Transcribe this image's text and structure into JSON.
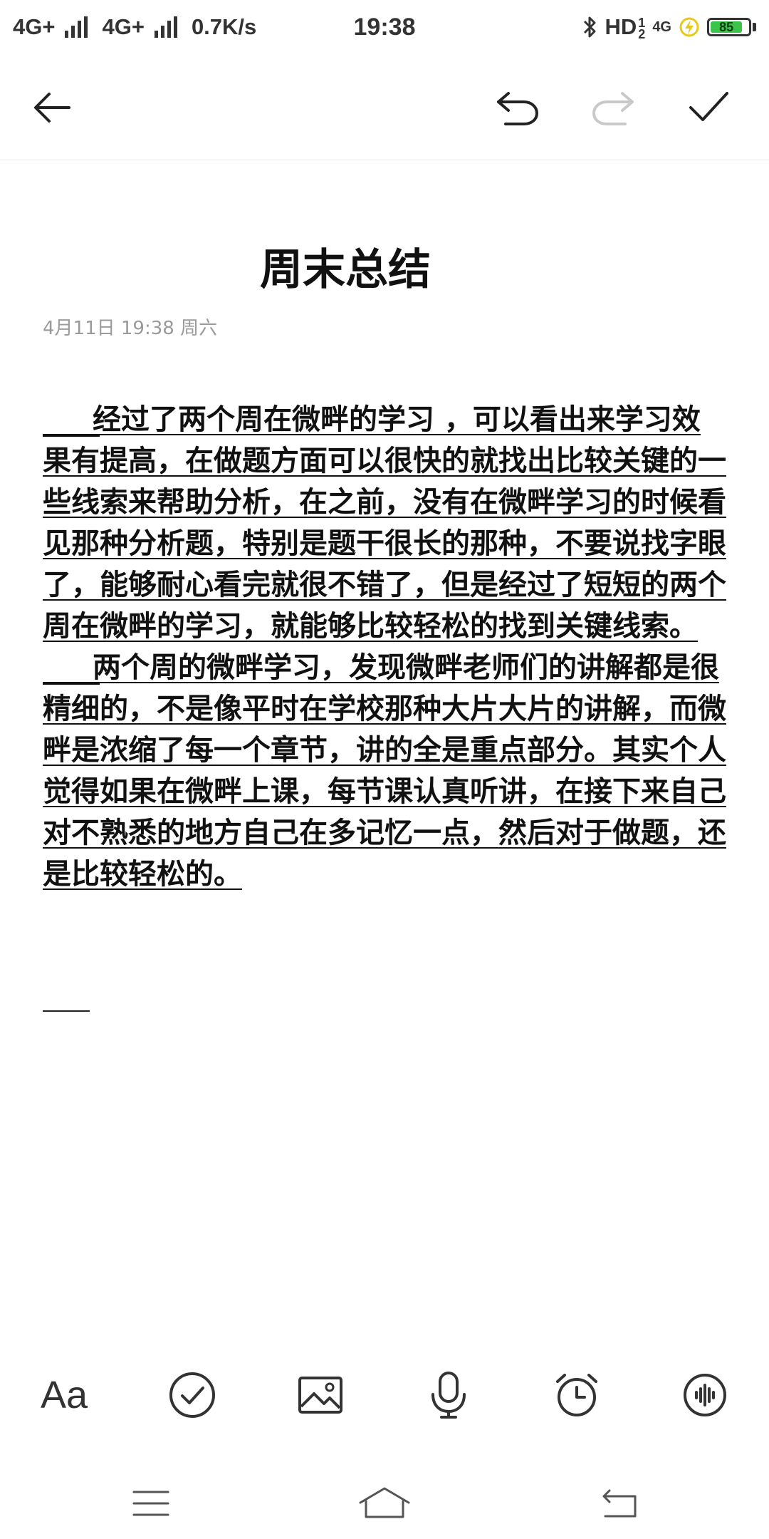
{
  "status_bar": {
    "net1": "4G+",
    "net2": "4G+",
    "speed": "0.7K/s",
    "time": "19:38",
    "hd": "HD",
    "hd_sub": "2",
    "hd_sup": "1",
    "net3": "4G",
    "battery": "85",
    "battery_fill": 0.85,
    "battery_color": "#3cc34a"
  },
  "toolbar": {
    "back_icon": "arrow-left-icon",
    "undo_icon": "undo-icon",
    "redo_icon": "redo-icon",
    "done_icon": "check-icon"
  },
  "note": {
    "title": "周末总结",
    "date": "4月11日 19:38 周六",
    "paragraphs": [
      "经过了两个周在微畔的学习 ，可以看出来学习效果有提高，在做题方面可以很快的就找出比较关键的一些线索来帮助分析，在之前，没有在微畔学习的时候看见那种分析题，特别是题干很长的那种，不要说找字眼了，能够耐心看完就很不错了，但是经过了短短的两个周在微畔的学习，就能够比较轻松的找到关键线索。",
      "两个周的微畔学习，发现微畔老师们的讲解都是很精细的，不是像平时在学校那种大片大片的讲解，而微畔是浓缩了每一个章节，讲的全是重点部分。其实个人觉得如果在微畔上课，每节课认真听讲，在接下来自己对不熟悉的地方自己在多记忆一点，然后对于做题，还是比较轻松的。"
    ]
  },
  "tools": {
    "font_label": "Aa",
    "checklist_icon": "checklist-icon",
    "image_icon": "image-icon",
    "mic_icon": "microphone-icon",
    "alarm_icon": "alarm-clock-icon",
    "voice_icon": "voice-wave-icon"
  },
  "nav": {
    "menu_icon": "menu-icon",
    "home_icon": "home-icon",
    "back_icon": "back-icon"
  }
}
